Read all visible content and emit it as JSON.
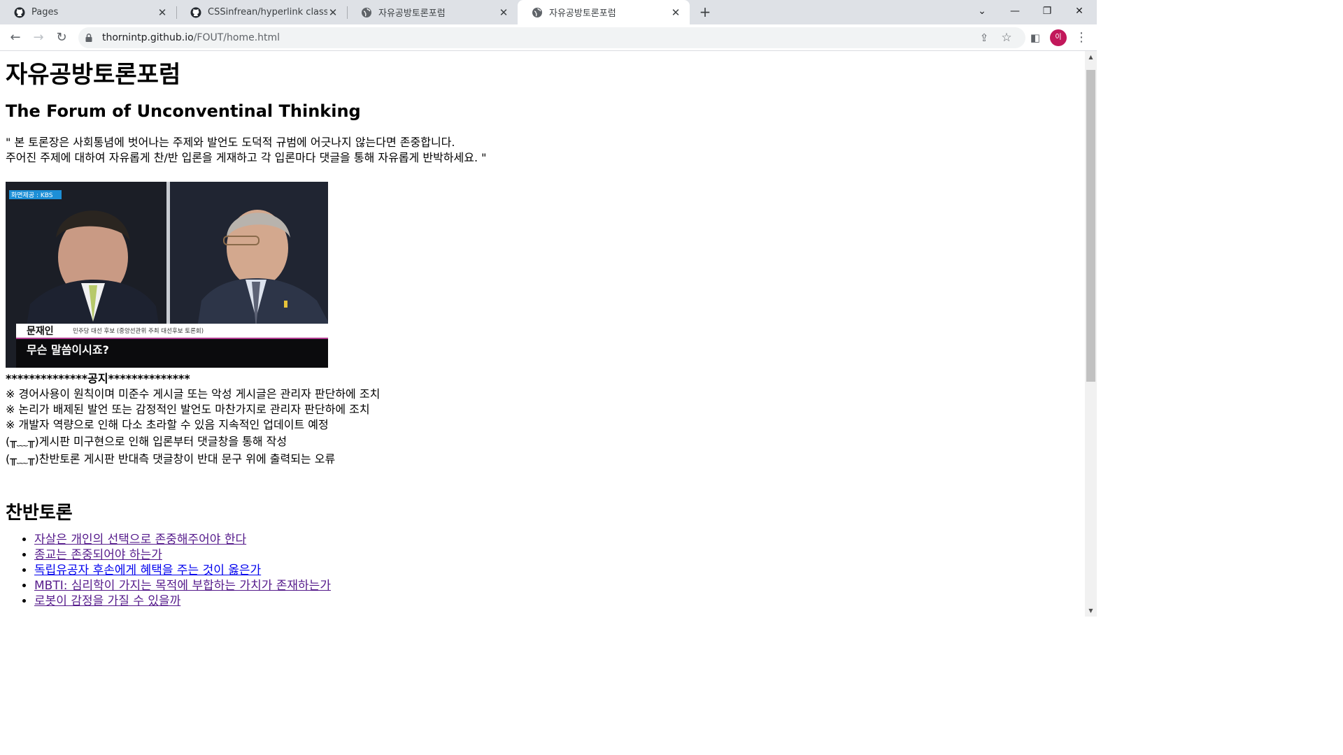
{
  "tabs": [
    {
      "title": "Pages",
      "icon": "github-icon"
    },
    {
      "title": "CSSinfrean/hyperlink class.html",
      "icon": "github-icon"
    },
    {
      "title": "자유공방토론포럼",
      "icon": "globe-icon"
    },
    {
      "title": "자유공방토론포럼",
      "icon": "globe-icon",
      "active": true
    }
  ],
  "toolbar": {
    "url_host": "thornintp.github.io",
    "url_path": "/FOUT/home.html",
    "profile_initial": "이"
  },
  "page": {
    "title": "자유공방토론포럼",
    "subtitle": "The Forum of Unconventinal Thinking",
    "quote_lines": [
      "\" 본 토론장은 사회통념에 벗어나는 주제와 발언도 도덕적 규범에 어긋나지 않는다면 존중합니다.",
      "주어진 주제에 대하여 자유롭게 찬/반 입론을 게재하고 각 입론마다 댓글을 통해 자유롭게 반박하세요. \""
    ],
    "image": {
      "caption_source": "화면제공 : KBS",
      "speaker_name": "문재인",
      "speaker_desc": "민주당 대선 후보 (중앙선관위 주최 대선후보 토론회)",
      "speech": "무슨 말씀이시죠?"
    },
    "notice": {
      "stars": "**************",
      "label": "공지",
      "lines": [
        "※ 경어사용이 원칙이며 미준수 게시글 또는 악성 게시글은 관리자 판단하에 조치",
        "※ 논리가 배제된 발언 또는 감정적인 발언도 마찬가지로 관리자 판단하에 조치",
        "※ 개발자 역량으로 인해 다소 초라할 수 있음 지속적인 업데이트 예정"
      ],
      "bug_lines": [
        "(╥﹏╥)게시판 미구현으로 인해 입론부터 댓글창을 통해 작성",
        "(╥﹏╥)찬반토론 게시판 반대측 댓글창이 반대 문구 위에 출력되는 오류"
      ]
    },
    "section_title": "찬반토론",
    "topics": [
      "자살은 개인의 선택으로 존중해주어야 한다",
      "종교는 존중되어야 하는가",
      "독립유공자 후손에게 혜택을 주는 것이 옳은가",
      "MBTI: 심리학이 가지는 목적에 부합하는 가치가 존재하는가",
      "로봇이 감정을 가질 수 있을까"
    ]
  }
}
